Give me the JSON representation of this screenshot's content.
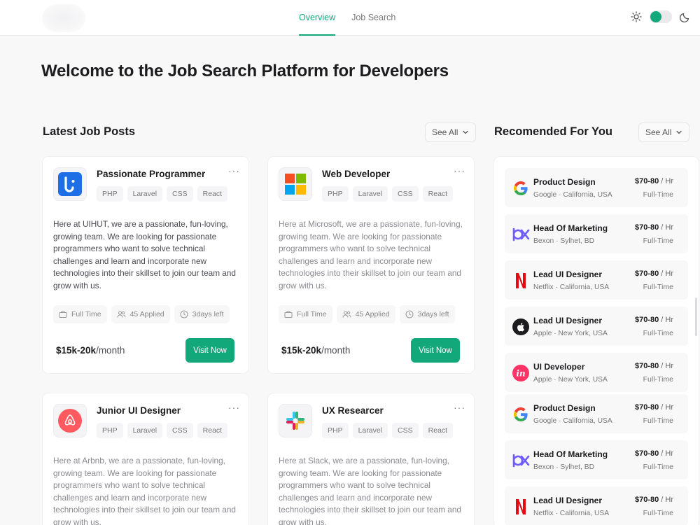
{
  "header": {
    "tabs": [
      {
        "label": "Overview",
        "active": true
      },
      {
        "label": "Job Search",
        "active": false
      }
    ],
    "accent_color": "#12a87a"
  },
  "page_title": "Welcome to the Job Search Platform for Developers",
  "latest": {
    "title": "Latest Job Posts",
    "see_all": "See All",
    "cards": [
      {
        "title": "Passionate Programmer",
        "tags": [
          "PHP",
          "Laravel",
          "CSS",
          "React"
        ],
        "description": "Here at UIHUT, we are a passionate, fun-loving, growing team. We are looking for passionate programmers who want to solve technical challenges and learn and incorporate new technologies into their skillset to join our team and grow with us.",
        "job_type": "Full Time",
        "applied": "45 Applied",
        "days_left": "3days left",
        "salary": "$15k-20k",
        "salary_unit": "/month",
        "button": "Visit Now",
        "logo": "uihut-logo-icon"
      },
      {
        "title": "Web Developer",
        "tags": [
          "PHP",
          "Laravel",
          "CSS",
          "React"
        ],
        "description": "Here at Microsoft, we are a passionate, fun-loving, growing team. We are looking for passionate programmers who want to solve technical challenges and learn and incorporate new technologies into their skillset to join our team and grow with us.",
        "job_type": "Full Time",
        "applied": "45 Applied",
        "days_left": "3days left",
        "salary": "$15k-20k",
        "salary_unit": "/month",
        "button": "Visit Now",
        "logo": "microsoft-logo-icon"
      },
      {
        "title": "Junior UI Designer",
        "tags": [
          "PHP",
          "Laravel",
          "CSS",
          "React"
        ],
        "description": "Here at Arbnb, we are a passionate, fun-loving, growing team. We are looking for passionate programmers who want to solve technical challenges and learn and incorporate new technologies into their skillset to join our team and grow with us.",
        "logo": "airbnb-logo-icon"
      },
      {
        "title": "UX Researcer",
        "tags": [
          "PHP",
          "Laravel",
          "CSS",
          "React"
        ],
        "description": "Here at Slack, we are a passionate, fun-loving, growing team. We are looking for passionate programmers who want to solve technical challenges and learn and incorporate new technologies into their skillset to join our team and grow with us.",
        "logo": "slack-logo-icon"
      }
    ]
  },
  "recommended": {
    "title": "Recomended For You",
    "see_all": "See All",
    "items": [
      {
        "title": "Product Design",
        "company": "Google",
        "location": "California, USA",
        "pay": "$70-80",
        "pay_unit": " / Hr",
        "type": "Full-Time",
        "logo": "google-logo-icon"
      },
      {
        "title": "Head Of Marketing",
        "company": "Bexon",
        "location": "Sylhet, BD",
        "pay": "$70-80",
        "pay_unit": " / Hr",
        "type": "Full-Time",
        "logo": "bexon-logo-icon"
      },
      {
        "title": "Lead UI Designer",
        "company": "Netflix",
        "location": "California, USA",
        "pay": "$70-80",
        "pay_unit": " / Hr",
        "type": "Full-Time",
        "logo": "netflix-logo-icon"
      },
      {
        "title": "Lead UI Designer",
        "company": "Apple",
        "location": "New York, USA",
        "pay": "$70-80",
        "pay_unit": " / Hr",
        "type": "Full-Time",
        "logo": "apple-logo-icon"
      },
      {
        "title": "UI Developer",
        "company": "Apple",
        "location": "New York, USA",
        "pay": "$70-80",
        "pay_unit": " / Hr",
        "type": "Full-Time",
        "logo": "invision-logo-icon"
      },
      {
        "title": "Product Design",
        "company": "Google",
        "location": "California, USA",
        "pay": "$70-80",
        "pay_unit": " / Hr",
        "type": "Full-Time",
        "logo": "google-logo-icon"
      },
      {
        "title": "Head Of Marketing",
        "company": "Bexon",
        "location": "Sylhet, BD",
        "pay": "$70-80",
        "pay_unit": " / Hr",
        "type": "Full-Time",
        "logo": "bexon-logo-icon"
      },
      {
        "title": "Lead UI Designer",
        "company": "Netflix",
        "location": "California, USA",
        "pay": "$70-80",
        "pay_unit": " / Hr",
        "type": "Full-Time",
        "logo": "netflix-logo-icon"
      }
    ]
  }
}
